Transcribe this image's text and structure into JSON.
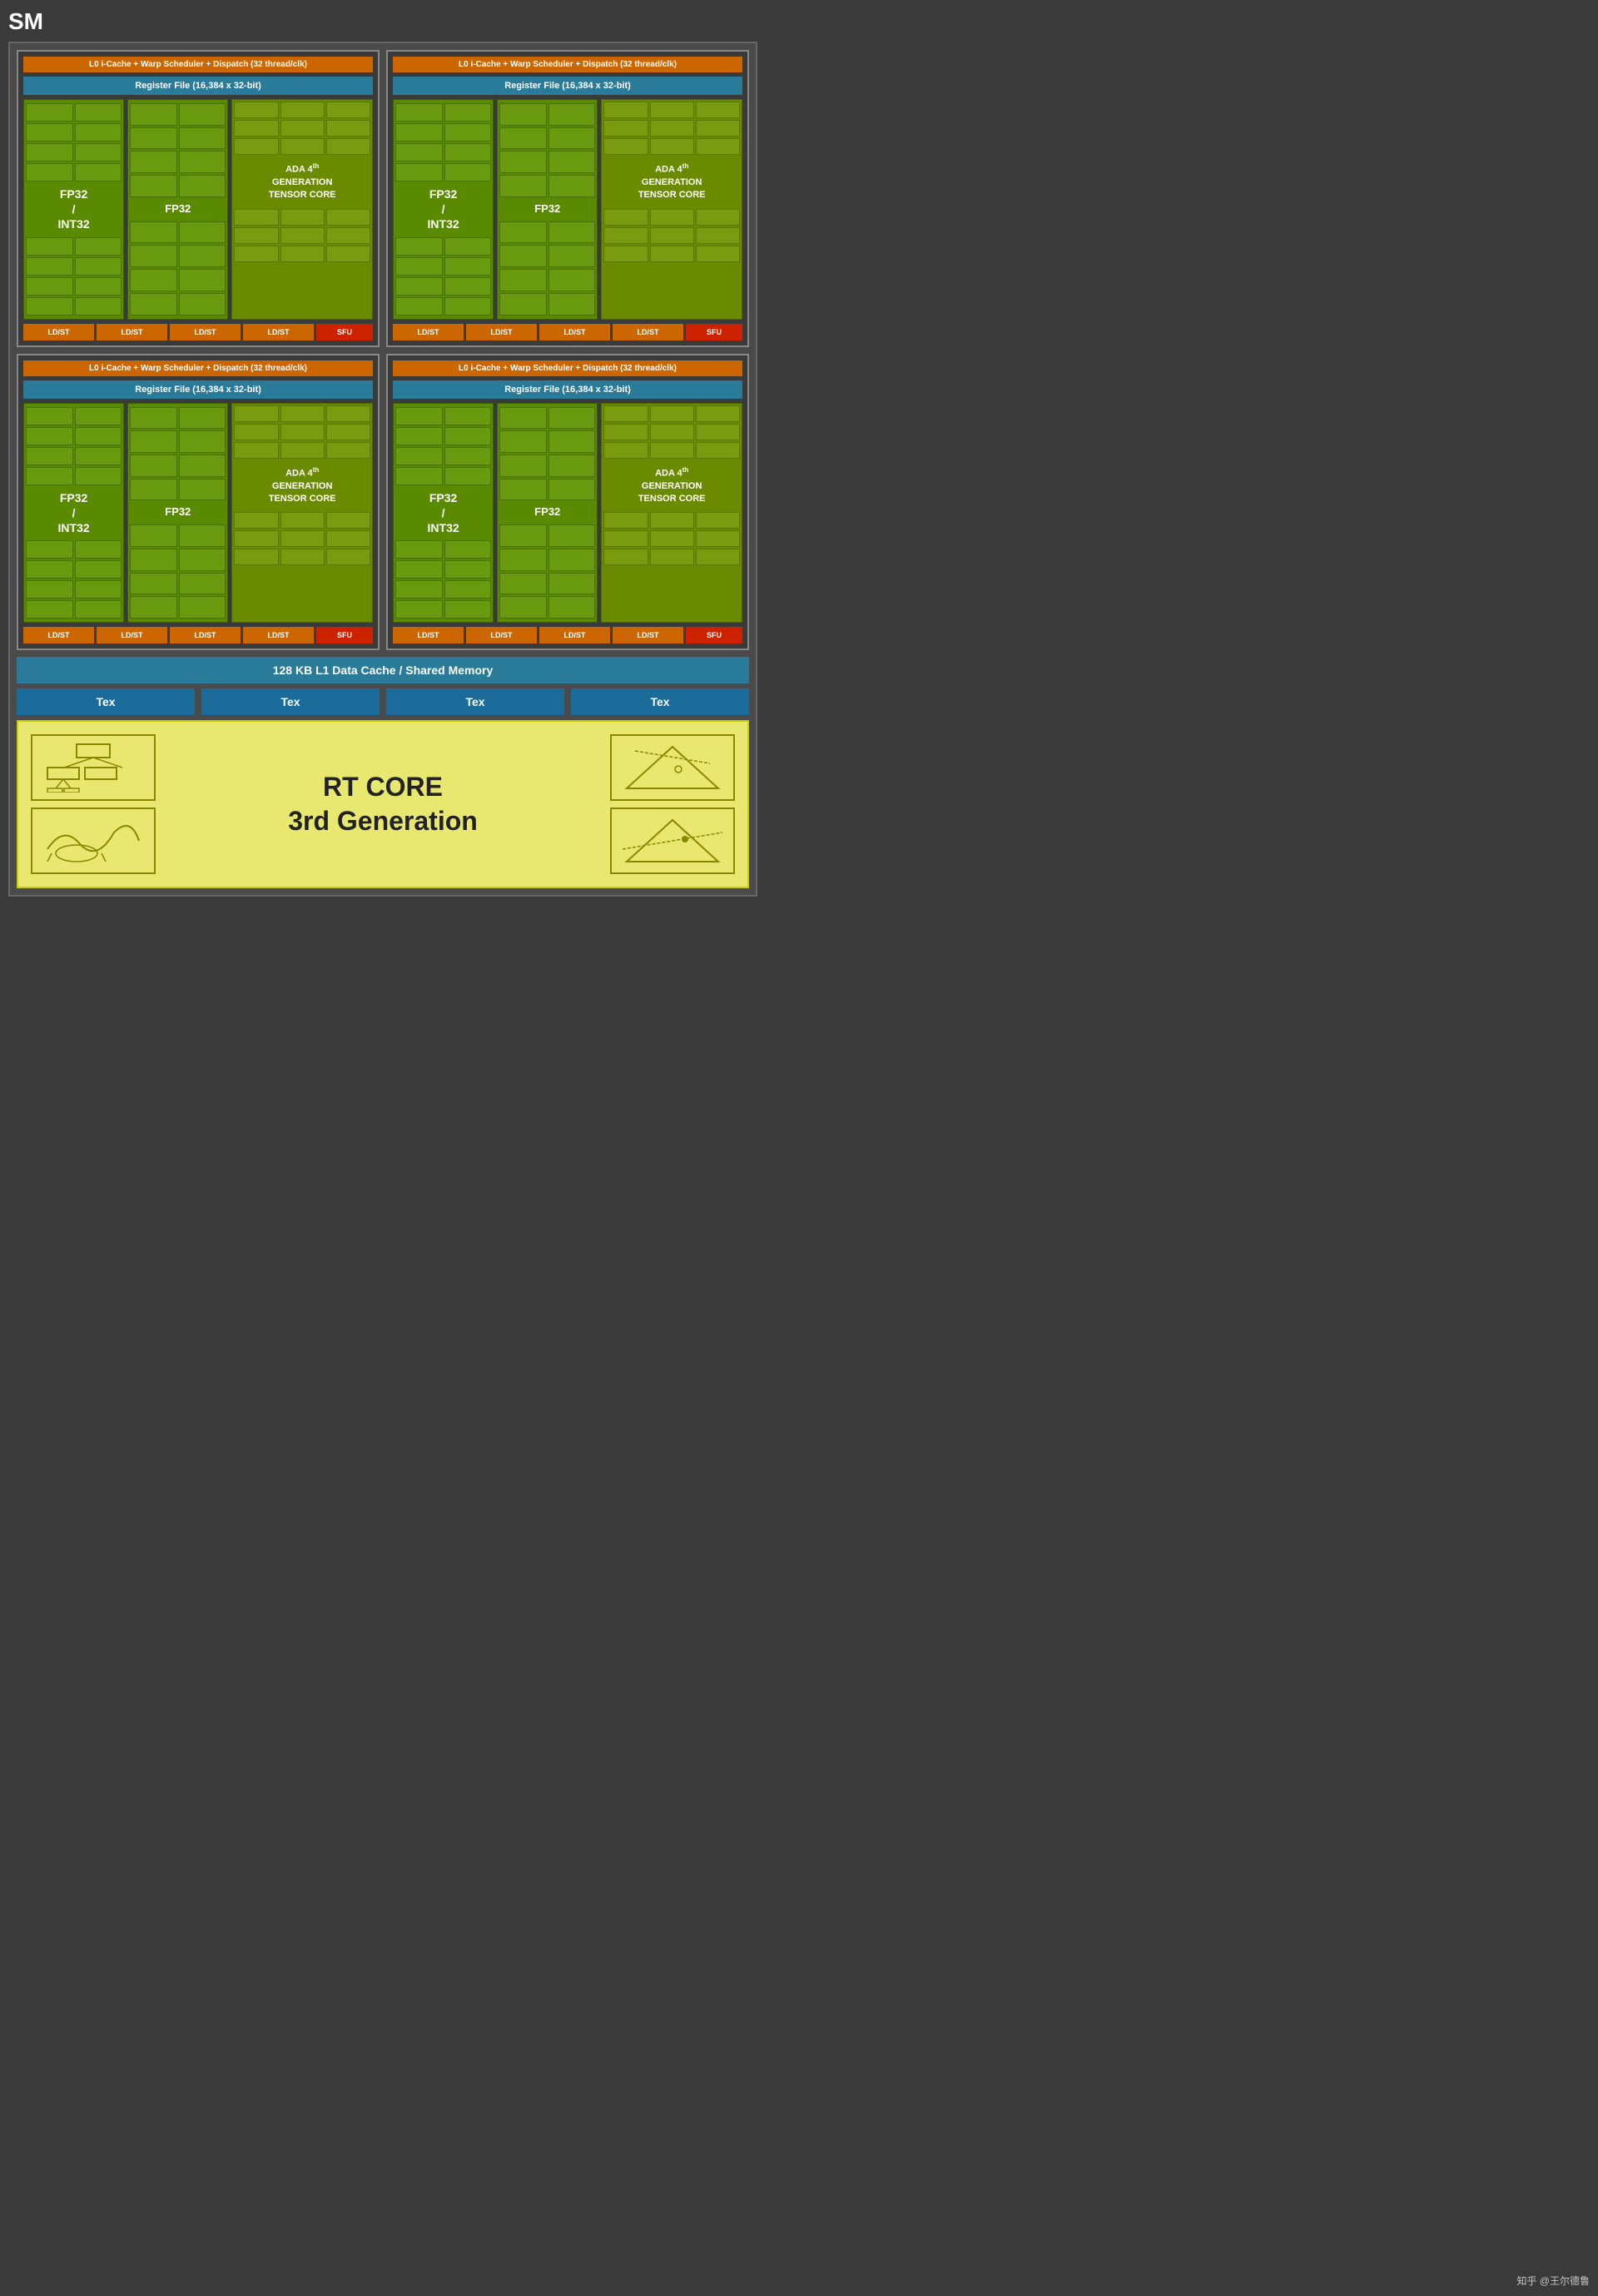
{
  "title": "SM",
  "quadrants": [
    {
      "id": "q1",
      "warp_label": "L0 i-Cache + Warp Scheduler + Dispatch (32 thread/clk)",
      "register_label": "Register File (16,384 x 32-bit)",
      "fp32_int32_label": "FP32\n/\nINT32",
      "fp32_label": "FP32",
      "tensor_label": "ADA 4th GENERATION TENSOR CORE",
      "ldst_labels": [
        "LD/ST",
        "LD/ST",
        "LD/ST",
        "LD/ST"
      ],
      "sfu_label": "SFU"
    },
    {
      "id": "q2",
      "warp_label": "L0 i-Cache + Warp Scheduler + Dispatch (32 thread/clk)",
      "register_label": "Register File (16,384 x 32-bit)",
      "fp32_int32_label": "FP32\n/\nINT32",
      "fp32_label": "FP32",
      "tensor_label": "ADA 4th GENERATION TENSOR CORE",
      "ldst_labels": [
        "LD/ST",
        "LD/ST",
        "LD/ST",
        "LD/ST"
      ],
      "sfu_label": "SFU"
    },
    {
      "id": "q3",
      "warp_label": "L0 i-Cache + Warp Scheduler + Dispatch (32 thread/clk)",
      "register_label": "Register File (16,384 x 32-bit)",
      "fp32_int32_label": "FP32\n/\nINT32",
      "fp32_label": "FP32",
      "tensor_label": "ADA 4th GENERATION TENSOR CORE",
      "ldst_labels": [
        "LD/ST",
        "LD/ST",
        "LD/ST",
        "LD/ST"
      ],
      "sfu_label": "SFU"
    },
    {
      "id": "q4",
      "warp_label": "L0 i-Cache + Warp Scheduler + Dispatch (32 thread/clk)",
      "register_label": "Register File (16,384 x 32-bit)",
      "fp32_int32_label": "FP32\n/\nINT32",
      "fp32_label": "FP32",
      "tensor_label": "ADA 4th GENERATION TENSOR CORE",
      "ldst_labels": [
        "LD/ST",
        "LD/ST",
        "LD/ST",
        "LD/ST"
      ],
      "sfu_label": "SFU"
    }
  ],
  "l1_cache_label": "128 KB L1 Data Cache / Shared Memory",
  "tex_labels": [
    "Tex",
    "Tex",
    "Tex",
    "Tex"
  ],
  "rt_core": {
    "title": "RT CORE",
    "subtitle": "3rd Generation"
  },
  "watermark": "知乎 @王尔德鲁"
}
